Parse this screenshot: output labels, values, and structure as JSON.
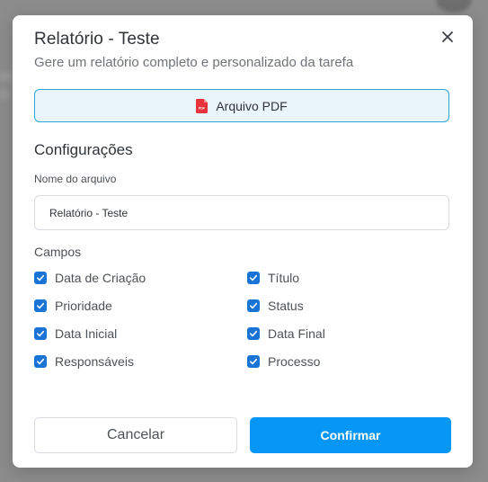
{
  "dialog": {
    "title": "Relatório - Teste",
    "subtitle": "Gere um relatório completo e personalizado da tarefa",
    "close_icon": "close-icon"
  },
  "format_button": {
    "label": "Arquivo PDF",
    "icon": "pdf-file-icon",
    "icon_badge": "PDF",
    "accent_color": "#2aa8d6",
    "background": "#e9f5fb"
  },
  "settings": {
    "section_title": "Configurações",
    "filename_label": "Nome do arquivo",
    "filename_value": "Relatório - Teste"
  },
  "fields": {
    "label": "Campos",
    "checkbox_color": "#1a74d6",
    "items": [
      {
        "label": "Data de Criação",
        "checked": true
      },
      {
        "label": "Título",
        "checked": true
      },
      {
        "label": "Prioridade",
        "checked": true
      },
      {
        "label": "Status",
        "checked": true
      },
      {
        "label": "Data Inicial",
        "checked": true
      },
      {
        "label": "Data Final",
        "checked": true
      },
      {
        "label": "Responsáveis",
        "checked": true
      },
      {
        "label": "Processo",
        "checked": true
      }
    ]
  },
  "actions": {
    "cancel_label": "Cancelar",
    "confirm_label": "Confirmar",
    "confirm_color": "#0696f5"
  }
}
